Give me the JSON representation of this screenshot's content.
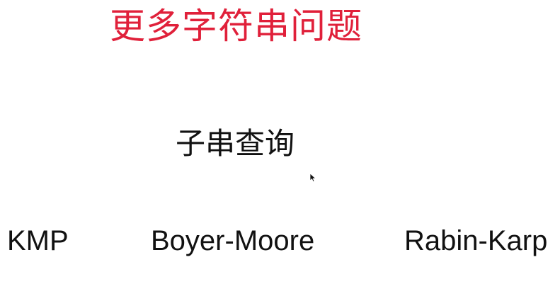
{
  "slide": {
    "title": "更多字符串问题",
    "subtitle": "子串查询",
    "algorithms": [
      "KMP",
      "Boyer-Moore",
      "Rabin-Karp"
    ],
    "colors": {
      "title": "#e0203a",
      "text": "#111111",
      "background": "#ffffff"
    },
    "icons": {
      "cursor": "mouse-pointer-icon"
    }
  }
}
